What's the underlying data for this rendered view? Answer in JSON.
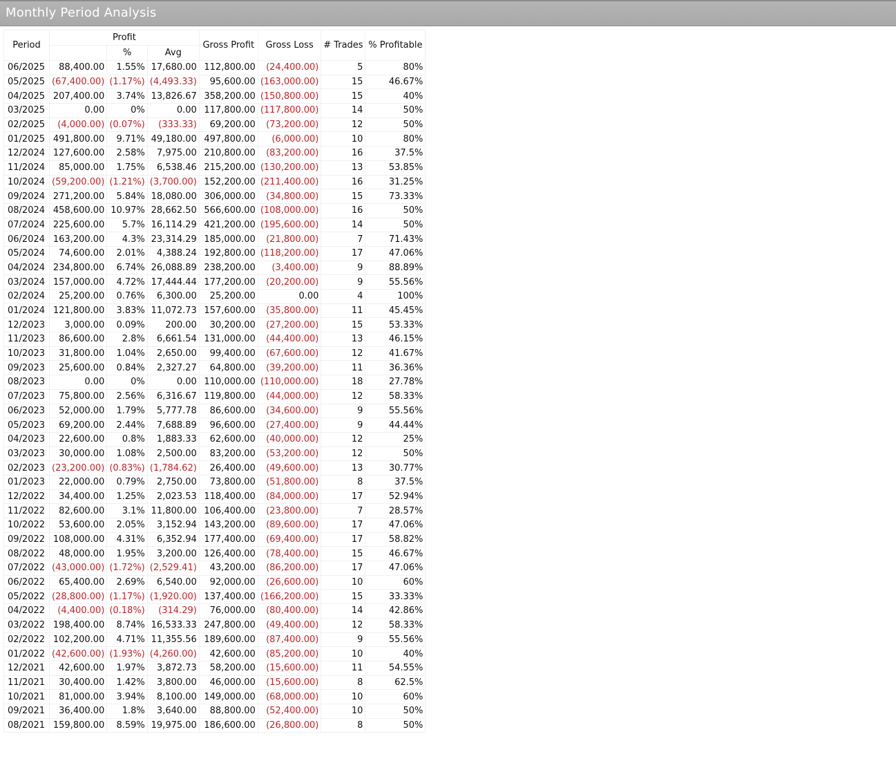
{
  "window": {
    "title": "Monthly Period Analysis"
  },
  "headers": {
    "period": "Period",
    "profit": "Profit",
    "profit_pct": "%",
    "profit_avg": "Avg",
    "gross_profit": "Gross Profit",
    "gross_loss": "Gross Loss",
    "trades": "# Trades",
    "pct_profitable": "% Profitable"
  },
  "colors": {
    "negative": "#c0262b",
    "title_bar": "#adadad"
  },
  "rows": [
    [
      "06/2025",
      "88,400.00",
      "1.55%",
      "17,680.00",
      "112,800.00",
      "(24,400.00)",
      "5",
      "80%"
    ],
    [
      "05/2025",
      "(67,400.00)",
      "(1.17%)",
      "(4,493.33)",
      "95,600.00",
      "(163,000.00)",
      "15",
      "46.67%"
    ],
    [
      "04/2025",
      "207,400.00",
      "3.74%",
      "13,826.67",
      "358,200.00",
      "(150,800.00)",
      "15",
      "40%"
    ],
    [
      "03/2025",
      "0.00",
      "0%",
      "0.00",
      "117,800.00",
      "(117,800.00)",
      "14",
      "50%"
    ],
    [
      "02/2025",
      "(4,000.00)",
      "(0.07%)",
      "(333.33)",
      "69,200.00",
      "(73,200.00)",
      "12",
      "50%"
    ],
    [
      "01/2025",
      "491,800.00",
      "9.71%",
      "49,180.00",
      "497,800.00",
      "(6,000.00)",
      "10",
      "80%"
    ],
    [
      "12/2024",
      "127,600.00",
      "2.58%",
      "7,975.00",
      "210,800.00",
      "(83,200.00)",
      "16",
      "37.5%"
    ],
    [
      "11/2024",
      "85,000.00",
      "1.75%",
      "6,538.46",
      "215,200.00",
      "(130,200.00)",
      "13",
      "53.85%"
    ],
    [
      "10/2024",
      "(59,200.00)",
      "(1.21%)",
      "(3,700.00)",
      "152,200.00",
      "(211,400.00)",
      "16",
      "31.25%"
    ],
    [
      "09/2024",
      "271,200.00",
      "5.84%",
      "18,080.00",
      "306,000.00",
      "(34,800.00)",
      "15",
      "73.33%"
    ],
    [
      "08/2024",
      "458,600.00",
      "10.97%",
      "28,662.50",
      "566,600.00",
      "(108,000.00)",
      "16",
      "50%"
    ],
    [
      "07/2024",
      "225,600.00",
      "5.7%",
      "16,114.29",
      "421,200.00",
      "(195,600.00)",
      "14",
      "50%"
    ],
    [
      "06/2024",
      "163,200.00",
      "4.3%",
      "23,314.29",
      "185,000.00",
      "(21,800.00)",
      "7",
      "71.43%"
    ],
    [
      "05/2024",
      "74,600.00",
      "2.01%",
      "4,388.24",
      "192,800.00",
      "(118,200.00)",
      "17",
      "47.06%"
    ],
    [
      "04/2024",
      "234,800.00",
      "6.74%",
      "26,088.89",
      "238,200.00",
      "(3,400.00)",
      "9",
      "88.89%"
    ],
    [
      "03/2024",
      "157,000.00",
      "4.72%",
      "17,444.44",
      "177,200.00",
      "(20,200.00)",
      "9",
      "55.56%"
    ],
    [
      "02/2024",
      "25,200.00",
      "0.76%",
      "6,300.00",
      "25,200.00",
      "0.00",
      "4",
      "100%"
    ],
    [
      "01/2024",
      "121,800.00",
      "3.83%",
      "11,072.73",
      "157,600.00",
      "(35,800.00)",
      "11",
      "45.45%"
    ],
    [
      "12/2023",
      "3,000.00",
      "0.09%",
      "200.00",
      "30,200.00",
      "(27,200.00)",
      "15",
      "53.33%"
    ],
    [
      "11/2023",
      "86,600.00",
      "2.8%",
      "6,661.54",
      "131,000.00",
      "(44,400.00)",
      "13",
      "46.15%"
    ],
    [
      "10/2023",
      "31,800.00",
      "1.04%",
      "2,650.00",
      "99,400.00",
      "(67,600.00)",
      "12",
      "41.67%"
    ],
    [
      "09/2023",
      "25,600.00",
      "0.84%",
      "2,327.27",
      "64,800.00",
      "(39,200.00)",
      "11",
      "36.36%"
    ],
    [
      "08/2023",
      "0.00",
      "0%",
      "0.00",
      "110,000.00",
      "(110,000.00)",
      "18",
      "27.78%"
    ],
    [
      "07/2023",
      "75,800.00",
      "2.56%",
      "6,316.67",
      "119,800.00",
      "(44,000.00)",
      "12",
      "58.33%"
    ],
    [
      "06/2023",
      "52,000.00",
      "1.79%",
      "5,777.78",
      "86,600.00",
      "(34,600.00)",
      "9",
      "55.56%"
    ],
    [
      "05/2023",
      "69,200.00",
      "2.44%",
      "7,688.89",
      "96,600.00",
      "(27,400.00)",
      "9",
      "44.44%"
    ],
    [
      "04/2023",
      "22,600.00",
      "0.8%",
      "1,883.33",
      "62,600.00",
      "(40,000.00)",
      "12",
      "25%"
    ],
    [
      "03/2023",
      "30,000.00",
      "1.08%",
      "2,500.00",
      "83,200.00",
      "(53,200.00)",
      "12",
      "50%"
    ],
    [
      "02/2023",
      "(23,200.00)",
      "(0.83%)",
      "(1,784.62)",
      "26,400.00",
      "(49,600.00)",
      "13",
      "30.77%"
    ],
    [
      "01/2023",
      "22,000.00",
      "0.79%",
      "2,750.00",
      "73,800.00",
      "(51,800.00)",
      "8",
      "37.5%"
    ],
    [
      "12/2022",
      "34,400.00",
      "1.25%",
      "2,023.53",
      "118,400.00",
      "(84,000.00)",
      "17",
      "52.94%"
    ],
    [
      "11/2022",
      "82,600.00",
      "3.1%",
      "11,800.00",
      "106,400.00",
      "(23,800.00)",
      "7",
      "28.57%"
    ],
    [
      "10/2022",
      "53,600.00",
      "2.05%",
      "3,152.94",
      "143,200.00",
      "(89,600.00)",
      "17",
      "47.06%"
    ],
    [
      "09/2022",
      "108,000.00",
      "4.31%",
      "6,352.94",
      "177,400.00",
      "(69,400.00)",
      "17",
      "58.82%"
    ],
    [
      "08/2022",
      "48,000.00",
      "1.95%",
      "3,200.00",
      "126,400.00",
      "(78,400.00)",
      "15",
      "46.67%"
    ],
    [
      "07/2022",
      "(43,000.00)",
      "(1.72%)",
      "(2,529.41)",
      "43,200.00",
      "(86,200.00)",
      "17",
      "47.06%"
    ],
    [
      "06/2022",
      "65,400.00",
      "2.69%",
      "6,540.00",
      "92,000.00",
      "(26,600.00)",
      "10",
      "60%"
    ],
    [
      "05/2022",
      "(28,800.00)",
      "(1.17%)",
      "(1,920.00)",
      "137,400.00",
      "(166,200.00)",
      "15",
      "33.33%"
    ],
    [
      "04/2022",
      "(4,400.00)",
      "(0.18%)",
      "(314.29)",
      "76,000.00",
      "(80,400.00)",
      "14",
      "42.86%"
    ],
    [
      "03/2022",
      "198,400.00",
      "8.74%",
      "16,533.33",
      "247,800.00",
      "(49,400.00)",
      "12",
      "58.33%"
    ],
    [
      "02/2022",
      "102,200.00",
      "4.71%",
      "11,355.56",
      "189,600.00",
      "(87,400.00)",
      "9",
      "55.56%"
    ],
    [
      "01/2022",
      "(42,600.00)",
      "(1.93%)",
      "(4,260.00)",
      "42,600.00",
      "(85,200.00)",
      "10",
      "40%"
    ],
    [
      "12/2021",
      "42,600.00",
      "1.97%",
      "3,872.73",
      "58,200.00",
      "(15,600.00)",
      "11",
      "54.55%"
    ],
    [
      "11/2021",
      "30,400.00",
      "1.42%",
      "3,800.00",
      "46,000.00",
      "(15,600.00)",
      "8",
      "62.5%"
    ],
    [
      "10/2021",
      "81,000.00",
      "3.94%",
      "8,100.00",
      "149,000.00",
      "(68,000.00)",
      "10",
      "60%"
    ],
    [
      "09/2021",
      "36,400.00",
      "1.8%",
      "3,640.00",
      "88,800.00",
      "(52,400.00)",
      "10",
      "50%"
    ],
    [
      "08/2021",
      "159,800.00",
      "8.59%",
      "19,975.00",
      "186,600.00",
      "(26,800.00)",
      "8",
      "50%"
    ]
  ]
}
